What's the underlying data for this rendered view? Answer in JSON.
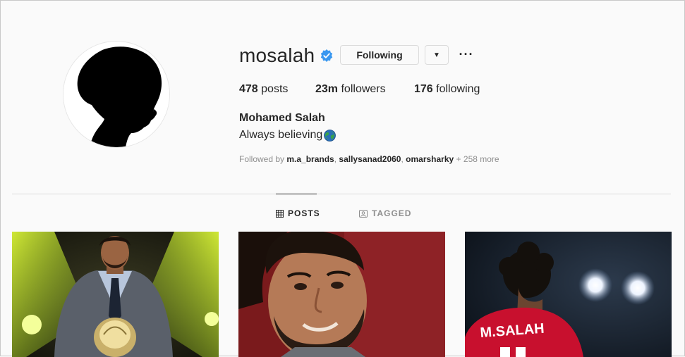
{
  "profile": {
    "username": "mosalah",
    "verified": true,
    "following_label": "Following",
    "dropdown_icon": "caret-down-icon",
    "more_icon": "ellipsis-icon",
    "stats": {
      "posts_count": "478",
      "posts_label": "posts",
      "followers_count": "23m",
      "followers_label": "followers",
      "following_count": "176",
      "following_label": "following"
    },
    "full_name": "Mohamed Salah",
    "bio": "Always believing",
    "followed_by": {
      "prefix": "Followed by ",
      "users": [
        "m.a_brands",
        "sallysanad2060",
        "omarsharky"
      ],
      "more": "+ 258 more"
    }
  },
  "tabs": [
    {
      "label": "POSTS",
      "icon": "grid-icon",
      "active": true
    },
    {
      "label": "TAGGED",
      "icon": "tag-icon",
      "active": false
    }
  ],
  "posts": [
    {
      "jersey_text": ""
    },
    {
      "jersey_text": ""
    },
    {
      "jersey_text": "M.SALAH"
    }
  ],
  "colors": {
    "verified": "#3897f0",
    "text": "#262626",
    "muted": "#8e8e8e",
    "border": "#dbdbdb"
  }
}
